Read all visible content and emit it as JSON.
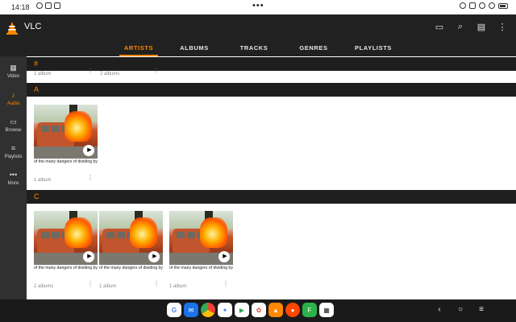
{
  "status_bar": {
    "time": "14:18",
    "left_icons": [
      "notification-icon",
      "message-icon",
      "gallery-icon"
    ],
    "right_icons": [
      "alarm-icon",
      "bluetooth-icon",
      "mute-icon",
      "wifi-icon",
      "battery-icon"
    ]
  },
  "app": {
    "title": "VLC",
    "actions": [
      {
        "name": "cast-icon",
        "glyph": "▭"
      },
      {
        "name": "search-icon",
        "glyph": "⌕"
      },
      {
        "name": "display-settings-icon",
        "glyph": "▤"
      },
      {
        "name": "overflow-menu-icon",
        "glyph": "⋮"
      }
    ],
    "tabs": [
      {
        "label": "ARTISTS",
        "active": true
      },
      {
        "label": "ALBUMS",
        "active": false
      },
      {
        "label": "TRACKS",
        "active": false
      },
      {
        "label": "GENRES",
        "active": false
      },
      {
        "label": "PLAYLISTS",
        "active": false
      }
    ]
  },
  "sidebar": {
    "items": [
      {
        "label": "Video",
        "icon": "video-icon",
        "glyph": "▦",
        "active": false
      },
      {
        "label": "Audio",
        "icon": "audio-icon",
        "glyph": "♪",
        "active": true
      },
      {
        "label": "Browse",
        "icon": "folder-icon",
        "glyph": "▭",
        "active": false
      },
      {
        "label": "Playlists",
        "icon": "playlist-icon",
        "glyph": "≡",
        "active": false
      },
      {
        "label": "More",
        "icon": "more-icon",
        "glyph": "•••",
        "active": false
      }
    ]
  },
  "sections": [
    {
      "header": "#",
      "items": [
        {
          "subtitle": "1 album"
        },
        {
          "subtitle": "2 albums"
        }
      ]
    },
    {
      "header": "A",
      "items": [
        {
          "caption": "of the many dangers of dividing by ze",
          "subtitle": "1 album"
        }
      ]
    },
    {
      "header": "C",
      "items": [
        {
          "caption": "of the many dangers of dividing by ze",
          "subtitle": "2 albums"
        },
        {
          "caption": "of the many dangers of dividing by ze",
          "subtitle": "1 album"
        },
        {
          "caption": "of the many dangers of dividing by ze",
          "subtitle": "1 album"
        }
      ]
    }
  ],
  "dock": {
    "apps": [
      {
        "name": "google-app-icon",
        "color": "#ffffff"
      },
      {
        "name": "messages-app-icon",
        "color": "#1a73e8"
      },
      {
        "name": "chrome-app-icon",
        "color": "#ffffff"
      },
      {
        "name": "assistant-app-icon",
        "color": "#ffffff"
      },
      {
        "name": "play-store-app-icon",
        "color": "#ffffff"
      },
      {
        "name": "photos-app-icon",
        "color": "#ffffff"
      },
      {
        "name": "vlc-app-icon",
        "color": "#ff8800"
      },
      {
        "name": "reddit-app-icon",
        "color": "#ff4500"
      },
      {
        "name": "feedly-app-icon",
        "color": "#2bb24c"
      },
      {
        "name": "qr-scanner-app-icon",
        "color": "#ffffff"
      }
    ]
  },
  "system_nav": [
    {
      "name": "back-icon",
      "glyph": "‹"
    },
    {
      "name": "home-icon",
      "glyph": "○"
    },
    {
      "name": "recents-icon",
      "glyph": "≡"
    }
  ],
  "colors": {
    "accent": "#ff8800",
    "appbar": "#212121",
    "sidebar": "#303030",
    "section_header": "#1e1e1e"
  }
}
